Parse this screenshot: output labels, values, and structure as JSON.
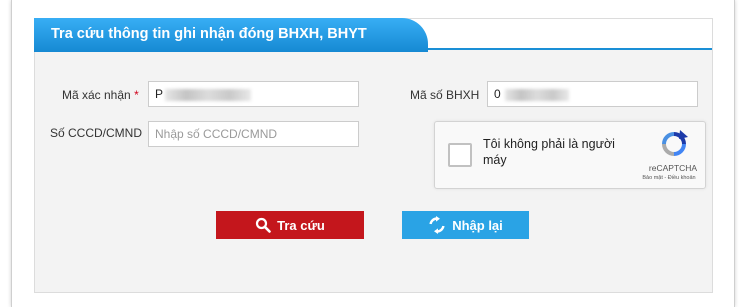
{
  "panel": {
    "title": "Tra cứu thông tin ghi nhận đóng BHXH, BHYT"
  },
  "form": {
    "confirm_code": {
      "label": "Mã xác nhận",
      "required_mark": "*",
      "value": "P"
    },
    "bhxh_code": {
      "label": "Mã số BHXH",
      "value": "0"
    },
    "cccd": {
      "label": "Số CCCD/CMND",
      "placeholder": "Nhập số CCCD/CMND"
    }
  },
  "captcha": {
    "text": "Tôi không phải là người máy",
    "brand": "reCAPTCHA",
    "links": "Bảo mật - Điều khoản",
    "icon": "recaptcha-logo"
  },
  "buttons": {
    "search_label": "Tra cứu",
    "search_icon": "search-icon",
    "reset_label": "Nhập lại",
    "reset_icon": "refresh-icon"
  },
  "colors": {
    "header_blue": "#1a8fd6",
    "search_red": "#c4161c",
    "reset_blue": "#2aa3e5"
  }
}
